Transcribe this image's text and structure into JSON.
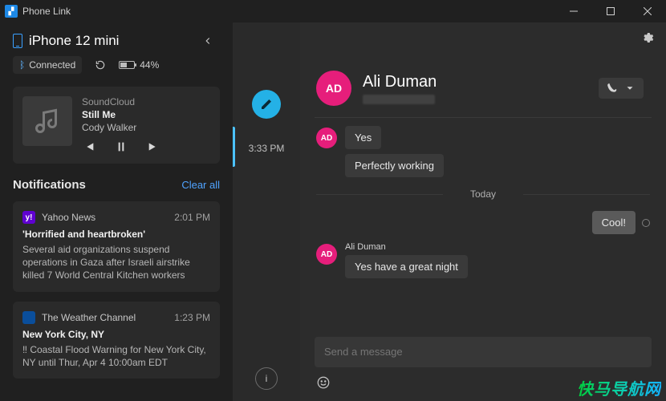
{
  "titlebar": {
    "app_name": "Phone Link"
  },
  "device": {
    "name": "iPhone 12 mini",
    "connection_label": "Connected",
    "battery_pct_label": "44%"
  },
  "media": {
    "source": "SoundCloud",
    "track": "Still Me",
    "artist": "Cody Walker"
  },
  "notifications": {
    "header": "Notifications",
    "clear_all_label": "Clear all",
    "items": [
      {
        "app_name": "Yahoo News",
        "app_initial": "y!",
        "time": "2:01 PM",
        "headline": "'Horrified and heartbroken'",
        "body": "Several aid organizations suspend operations in Gaza after Israeli airstrike killed 7 World Central Kitchen workers"
      },
      {
        "app_name": "The Weather Channel",
        "app_initial": "",
        "time": "1:23 PM",
        "headline": "New York City, NY",
        "body": "‼ Coastal Flood Warning for New York City, NY until Thur, Apr 4 10:00am EDT"
      }
    ]
  },
  "midcol": {
    "selected_time": "3:33 PM"
  },
  "contact": {
    "initials": "AD",
    "name": "Ali Duman"
  },
  "conversation": {
    "prev": {
      "sender_initials": "AD",
      "bubbles": [
        "Yes",
        "Perfectly working"
      ]
    },
    "separator_label": "Today",
    "outgoing": {
      "text": "Cool!"
    },
    "latest": {
      "sender_initials": "AD",
      "sender_name": "Ali Duman",
      "bubbles": [
        "Yes have a great night"
      ]
    }
  },
  "composer": {
    "placeholder": "Send a message"
  },
  "watermark": "快马导航网"
}
